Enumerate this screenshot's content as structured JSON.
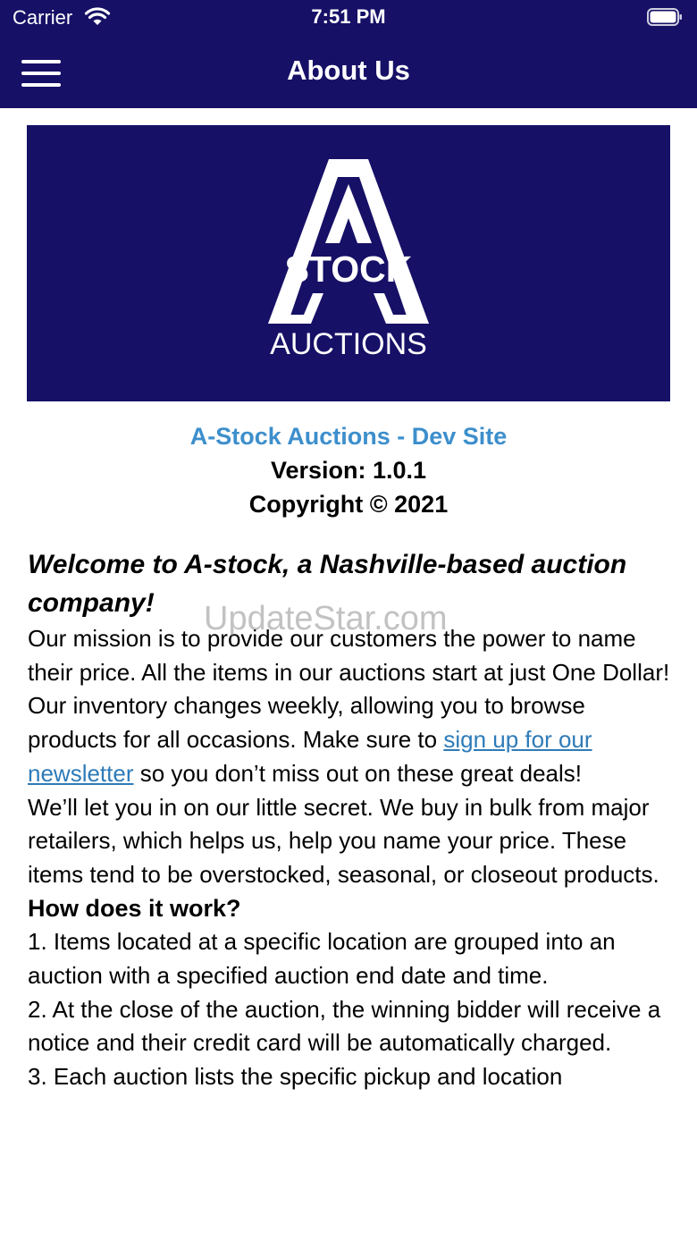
{
  "status_bar": {
    "carrier": "Carrier",
    "time": "7:51 PM"
  },
  "navbar": {
    "title": "About Us",
    "menu_icon": "hamburger-menu-icon"
  },
  "logo": {
    "stock_text": "STOCK",
    "auctions_text": "AUCTIONS",
    "background_color": "#161066"
  },
  "site_info": {
    "name": "A-Stock Auctions - Dev Site",
    "version": "Version: 1.0.1",
    "copyright": "Copyright © 2021"
  },
  "content": {
    "welcome": "Welcome to A-stock, a Nashville-based auction company!",
    "mission": "Our mission is to provide our customers the power to name their price. All the items in our auctions start at just One Dollar!",
    "inventory_before_link": "Our inventory changes weekly, allowing you to browse products for all occasions. Make sure to ",
    "newsletter_link": "sign up for our newsletter",
    "inventory_after_link": " so you don’t miss out on these great deals!",
    "secret": "We’ll let you in on our little secret. We buy in bulk from major retailers, which helps us, help you name your price. These items tend to be overstocked, seasonal, or closeout products.",
    "how_heading": "How does it work?",
    "step1": "1. Items located at a specific location are grouped into an auction with a specified auction end date and time.",
    "step2": "2. At the close of the auction, the winning bidder will receive a notice and their credit card will be automatically charged.",
    "step3": "3. Each auction lists the specific pickup and location"
  },
  "watermark": "UpdateStar.com",
  "colors": {
    "header": "#161066",
    "site_name": "#3d8fcc",
    "link": "#2e7bb8"
  }
}
